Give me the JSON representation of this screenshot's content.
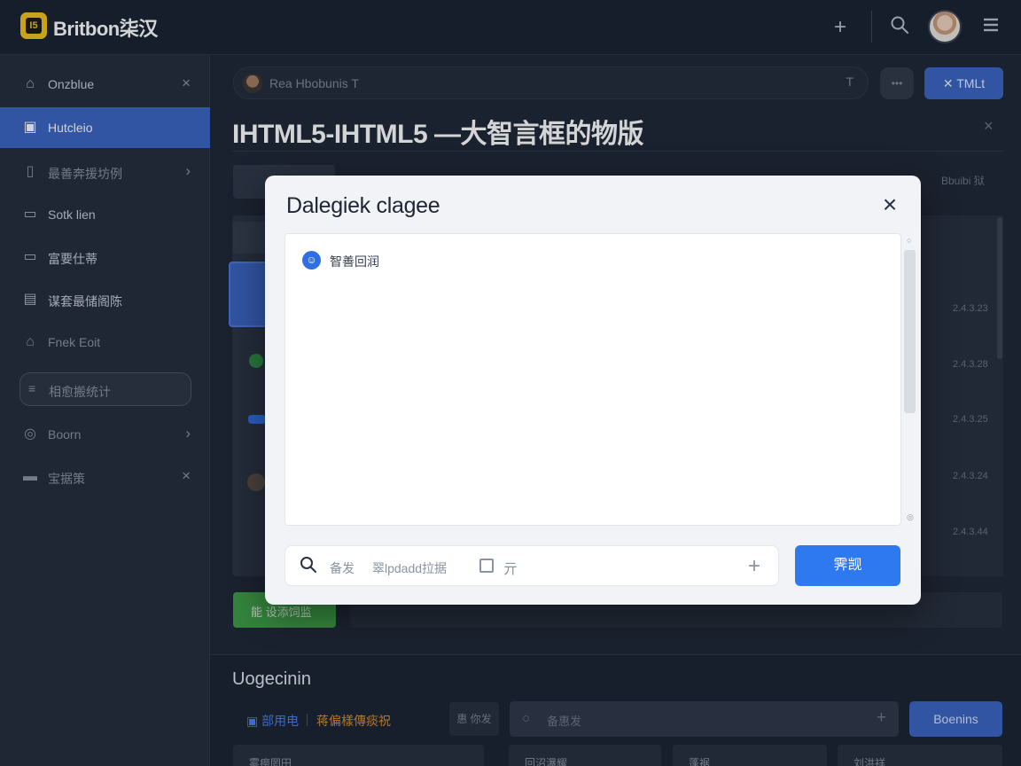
{
  "app": {
    "logo_text": "I5",
    "brand": "Britbon柒汉"
  },
  "topbar": {
    "add_icon": "+",
    "search_icon": "search-icon",
    "menu_icon": "menu-icon"
  },
  "sidebar": {
    "items": [
      {
        "label": "Onzblue",
        "icon": "home-icon",
        "tail": "×"
      },
      {
        "label": "Hutcleio",
        "icon": "folder-icon",
        "tail": ""
      },
      {
        "label": "最善奔援坊例",
        "icon": "document-icon",
        "tail": "›"
      },
      {
        "label": "Sotk lien",
        "icon": "card-icon",
        "tail": ""
      },
      {
        "label": "富要仕蒂",
        "icon": "monitor-icon",
        "tail": ""
      },
      {
        "label": "谋套最储阁陈",
        "icon": "layout-icon",
        "tail": ""
      },
      {
        "label": "Fnek Eoit",
        "icon": "home-icon",
        "tail": ""
      }
    ],
    "pill_label": "相愈搬统计",
    "items_lower": [
      {
        "label": "Boorn",
        "icon": "target-icon",
        "tail": "›"
      },
      {
        "label": "宝据策",
        "icon": "drive-icon",
        "tail": "×"
      }
    ]
  },
  "main": {
    "toolbar_text": "Rea   Hbobunis   T",
    "toolbar_end": "T",
    "round_btn": "",
    "html_btn": "TMLt",
    "title": "IHTML5-IHTML5 —大智言框的物版",
    "title_close": "×",
    "right_header": "Bbuibi 狱",
    "dates": [
      "2.4.3.23",
      "2.4.3.28",
      "2.4.3.25",
      "2.4.3.24",
      "2.4.3.44"
    ],
    "green_btn": "能 设添饲监"
  },
  "section": {
    "title": "Uogecinin",
    "tag_blue": "部用电",
    "tag_orange": "蒋偏樣傳痰祝",
    "chip": "惠 你发",
    "search_placeholder": "备惠发",
    "button": "Boenins",
    "cards": [
      "雾痨罔田",
      "回沼瀑耀",
      "蓬裾",
      "刘洪祥"
    ]
  },
  "dialog": {
    "title": "Dalegiek clagee",
    "message": "智善回润",
    "input_prefix": "备发",
    "input_placeholder": "翠lpdadd拉据",
    "input_aux": "亓",
    "submit": "霁觊"
  }
}
